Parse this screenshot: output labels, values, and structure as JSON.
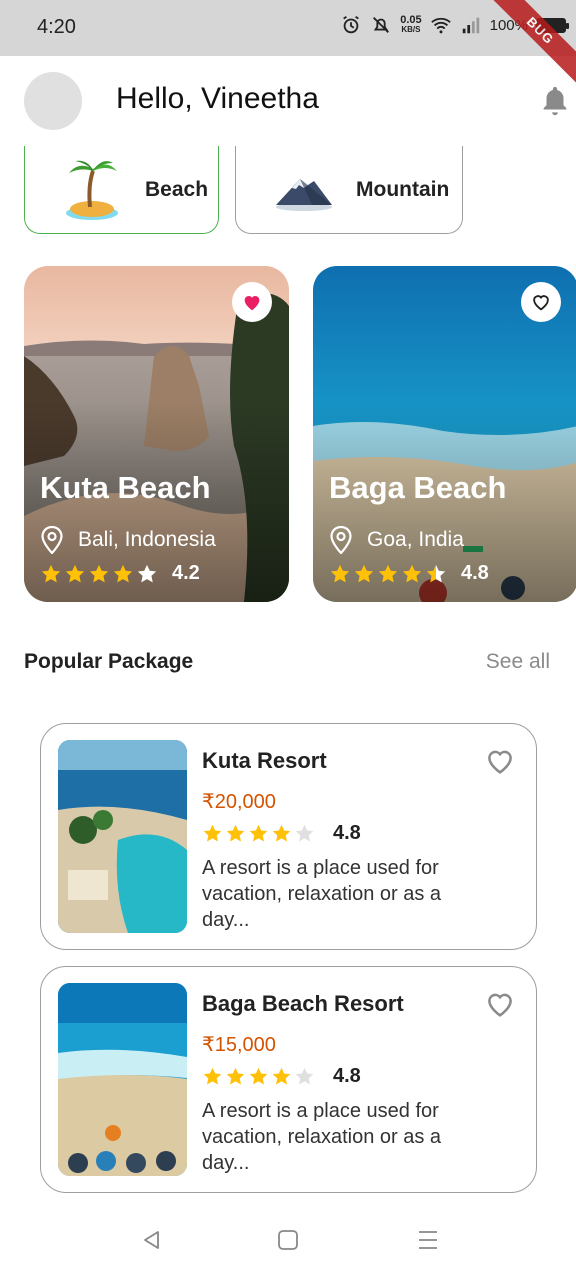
{
  "status_bar": {
    "time": "4:20",
    "speed_value": "0.05",
    "speed_unit": "KB/S",
    "battery": "100%",
    "debug_banner": "BUG"
  },
  "header": {
    "greeting": "Hello, Vineetha",
    "bell_icon": "bell-icon"
  },
  "categories": [
    {
      "label": "Beach",
      "icon": "palm-island-icon",
      "selected": true
    },
    {
      "label": "Mountain",
      "icon": "mountain-icon",
      "selected": false
    }
  ],
  "destinations": [
    {
      "name": "Kuta Beach",
      "location": "Bali, Indonesia",
      "rating": "4.2",
      "stars": 4,
      "favorite": true
    },
    {
      "name": "Baga Beach",
      "location": "Goa, India",
      "rating": "4.8",
      "stars": 4.5,
      "favorite": false
    }
  ],
  "popular": {
    "title": "Popular Package",
    "see_all": "See all",
    "packages": [
      {
        "name": "Kuta Resort",
        "price": "₹20,000",
        "rating": "4.8",
        "stars": 4,
        "description": "A resort is a place used for vacation, relaxation or as a day..."
      },
      {
        "name": "Baga Beach Resort",
        "price": "₹15,000",
        "rating": "4.8",
        "stars": 4,
        "description": "A resort is a place used for vacation, relaxation or as a day..."
      }
    ]
  },
  "colors": {
    "accent_green": "#4caf50",
    "price_orange": "#d35400",
    "favorite_pink": "#e91e63",
    "star_yellow": "#ffc107"
  }
}
